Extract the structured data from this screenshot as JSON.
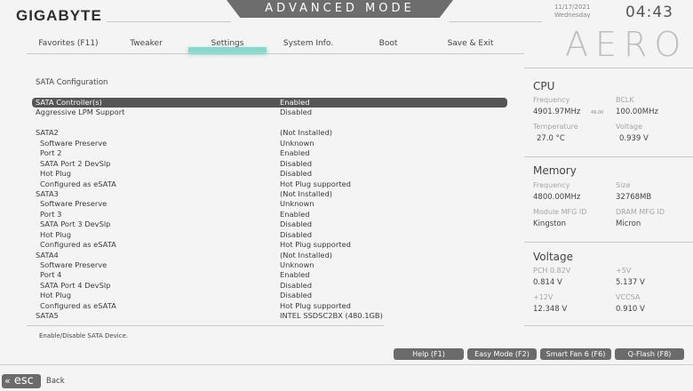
{
  "header": {
    "logo": "GIGABYTE",
    "mode_title": "ADVANCED MODE",
    "date": "11/17/2021",
    "weekday": "Wednesday",
    "time": "04:43",
    "brand": "AERO"
  },
  "tabs": [
    {
      "label": "Favorites (F11)"
    },
    {
      "label": "Tweaker"
    },
    {
      "label": "Settings",
      "active": true
    },
    {
      "label": "System Info."
    },
    {
      "label": "Boot"
    },
    {
      "label": "Save & Exit"
    }
  ],
  "section_title": "SATA Configuration",
  "settings": [
    {
      "label": "SATA Controller(s)",
      "value": "Enabled",
      "selected": true
    },
    {
      "label": "Aggressive LPM Support",
      "value": "Disabled"
    },
    {
      "label": "SATA2",
      "value": "(Not Installed)"
    },
    {
      "label": "Software Preserve",
      "value": "Unknown",
      "sub": true
    },
    {
      "label": "Port 2",
      "value": "Enabled",
      "sub": true
    },
    {
      "label": "SATA Port 2 DevSlp",
      "value": "Disabled",
      "sub": true
    },
    {
      "label": "Hot Plug",
      "value": "Disabled",
      "sub": true
    },
    {
      "label": "Configured as eSATA",
      "value": "Hot Plug supported",
      "sub": true
    },
    {
      "label": "SATA3",
      "value": "(Not Installed)"
    },
    {
      "label": "Software Preserve",
      "value": "Unknown",
      "sub": true
    },
    {
      "label": "Port 3",
      "value": "Enabled",
      "sub": true
    },
    {
      "label": "SATA Port 3 DevSlp",
      "value": "Disabled",
      "sub": true
    },
    {
      "label": "Hot Plug",
      "value": "Disabled",
      "sub": true
    },
    {
      "label": "Configured as eSATA",
      "value": "Hot Plug supported",
      "sub": true
    },
    {
      "label": "SATA4",
      "value": "(Not Installed)"
    },
    {
      "label": "Software Preserve",
      "value": "Unknown",
      "sub": true
    },
    {
      "label": "Port 4",
      "value": "Enabled",
      "sub": true
    },
    {
      "label": "SATA Port 4 DevSlp",
      "value": "Disabled",
      "sub": true
    },
    {
      "label": "Hot Plug",
      "value": "Disabled",
      "sub": true
    },
    {
      "label": "Configured as eSATA",
      "value": "Hot Plug supported",
      "sub": true
    },
    {
      "label": "SATA5",
      "value": "INTEL SSDSC2BX (480.1GB)"
    }
  ],
  "help_text": "Enable/Disable SATA Device.",
  "cpu": {
    "title": "CPU",
    "frequency_label": "Frequency",
    "frequency": "4901.97MHz",
    "ratio": "49.00",
    "bclk_label": "BCLK",
    "bclk": "100.00MHz",
    "temperature_label": "Temperature",
    "temperature": "27.0 °C",
    "voltage_label": "Voltage",
    "voltage": "0.939 V"
  },
  "memory": {
    "title": "Memory",
    "frequency_label": "Frequency",
    "frequency": "4800.00MHz",
    "size_label": "Size",
    "size": "32768MB",
    "module_mfg_label": "Module MFG ID",
    "module_mfg": "Kingston",
    "dram_mfg_label": "DRAM MFG ID",
    "dram_mfg": "Micron"
  },
  "voltage": {
    "title": "Voltage",
    "pch_label": "PCH 0.82V",
    "pch": "0.814 V",
    "v5_label": "+5V",
    "v5": "5.137 V",
    "v12_label": "+12V",
    "v12": "12.348 V",
    "vccsa_label": "VCCSA",
    "vccsa": "0.910 V"
  },
  "buttons": {
    "help": "Help (F1)",
    "easy_mode": "Easy Mode (F2)",
    "smart_fan": "Smart Fan 6 (F6)",
    "qflash": "Q-Flash (F8)"
  },
  "esc": {
    "key": "esc",
    "label": "Back"
  }
}
